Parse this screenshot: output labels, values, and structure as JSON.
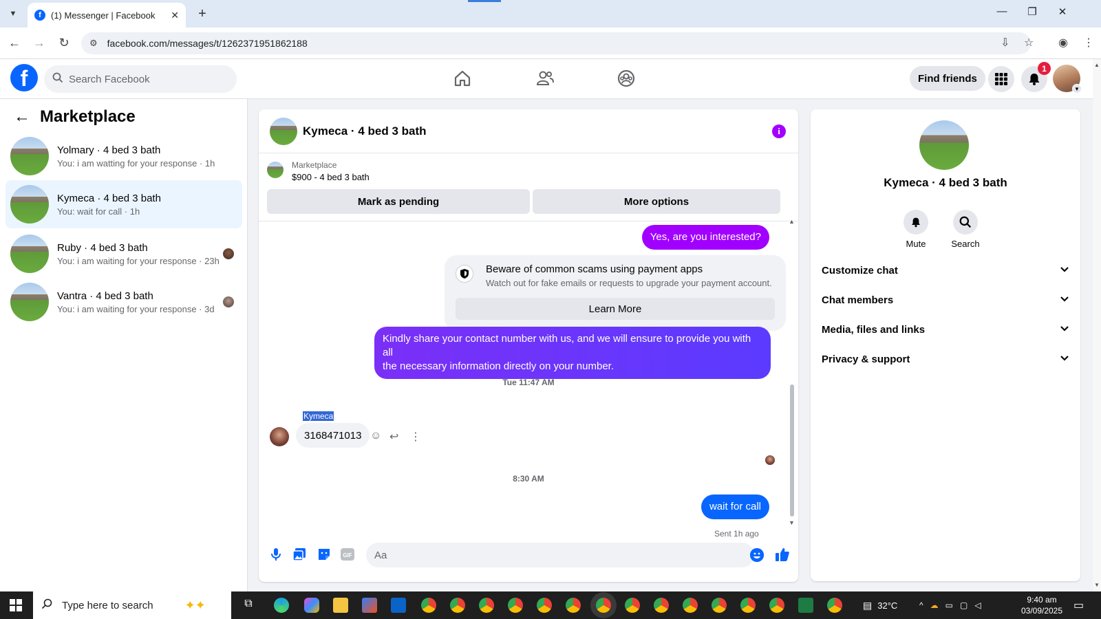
{
  "browser": {
    "tab_title": "(1) Messenger | Facebook",
    "url": "facebook.com/messages/t/1262371951862188"
  },
  "header": {
    "search_placeholder": "Search Facebook",
    "find_friends": "Find friends",
    "notification_count": "1"
  },
  "sidebar": {
    "title": "Marketplace",
    "conversations": [
      {
        "name": "Yolmary · 4 bed 3 bath",
        "last": "You: i am watting for your response · 1h"
      },
      {
        "name": "Kymeca · 4 bed 3 bath",
        "last": "You: wait for call · 1h"
      },
      {
        "name": "Ruby · 4 bed 3 bath",
        "last": "You: i am waiting for your response · 23h"
      },
      {
        "name": "Vantra · 4 bed 3 bath",
        "last": "You: i am waiting for your response · 3d"
      }
    ]
  },
  "chat": {
    "title": "Kymeca · 4 bed 3 bath",
    "listing_source": "Marketplace",
    "listing_price": "$900 - 4 bed 3 bath",
    "mark_pending": "Mark as pending",
    "more_options": "More options",
    "msg1": "Yes, are you interested?",
    "scam_title": "Beware of common scams using payment apps",
    "scam_desc": "Watch out for fake emails or requests to upgrade your payment account.",
    "learn_more": "Learn More",
    "msg2_line1": "Kindly share your contact number with us, and we will ensure to provide you with all",
    "msg2_line2": "the necessary information directly on your number.",
    "time1": "Tue 11:47 AM",
    "sender_name": "Kymeca",
    "msg_in": "3168471013",
    "time2": "8:30 AM",
    "msg3": "wait for call",
    "sent_status": "Sent 1h ago",
    "composer_placeholder": "Aa"
  },
  "details": {
    "name": "Kymeca · 4 bed 3 bath",
    "mute": "Mute",
    "search": "Search",
    "rows": [
      "Customize chat",
      "Chat members",
      "Media, files and links",
      "Privacy & support"
    ]
  },
  "taskbar": {
    "search_placeholder": "Type here to search",
    "temperature": "32°C",
    "time": "9:40 am",
    "date": "03/09/2025"
  },
  "colors": {
    "fb_blue": "#0866ff",
    "purple": "#a100ff",
    "active_conv": "#ebf5ff"
  }
}
